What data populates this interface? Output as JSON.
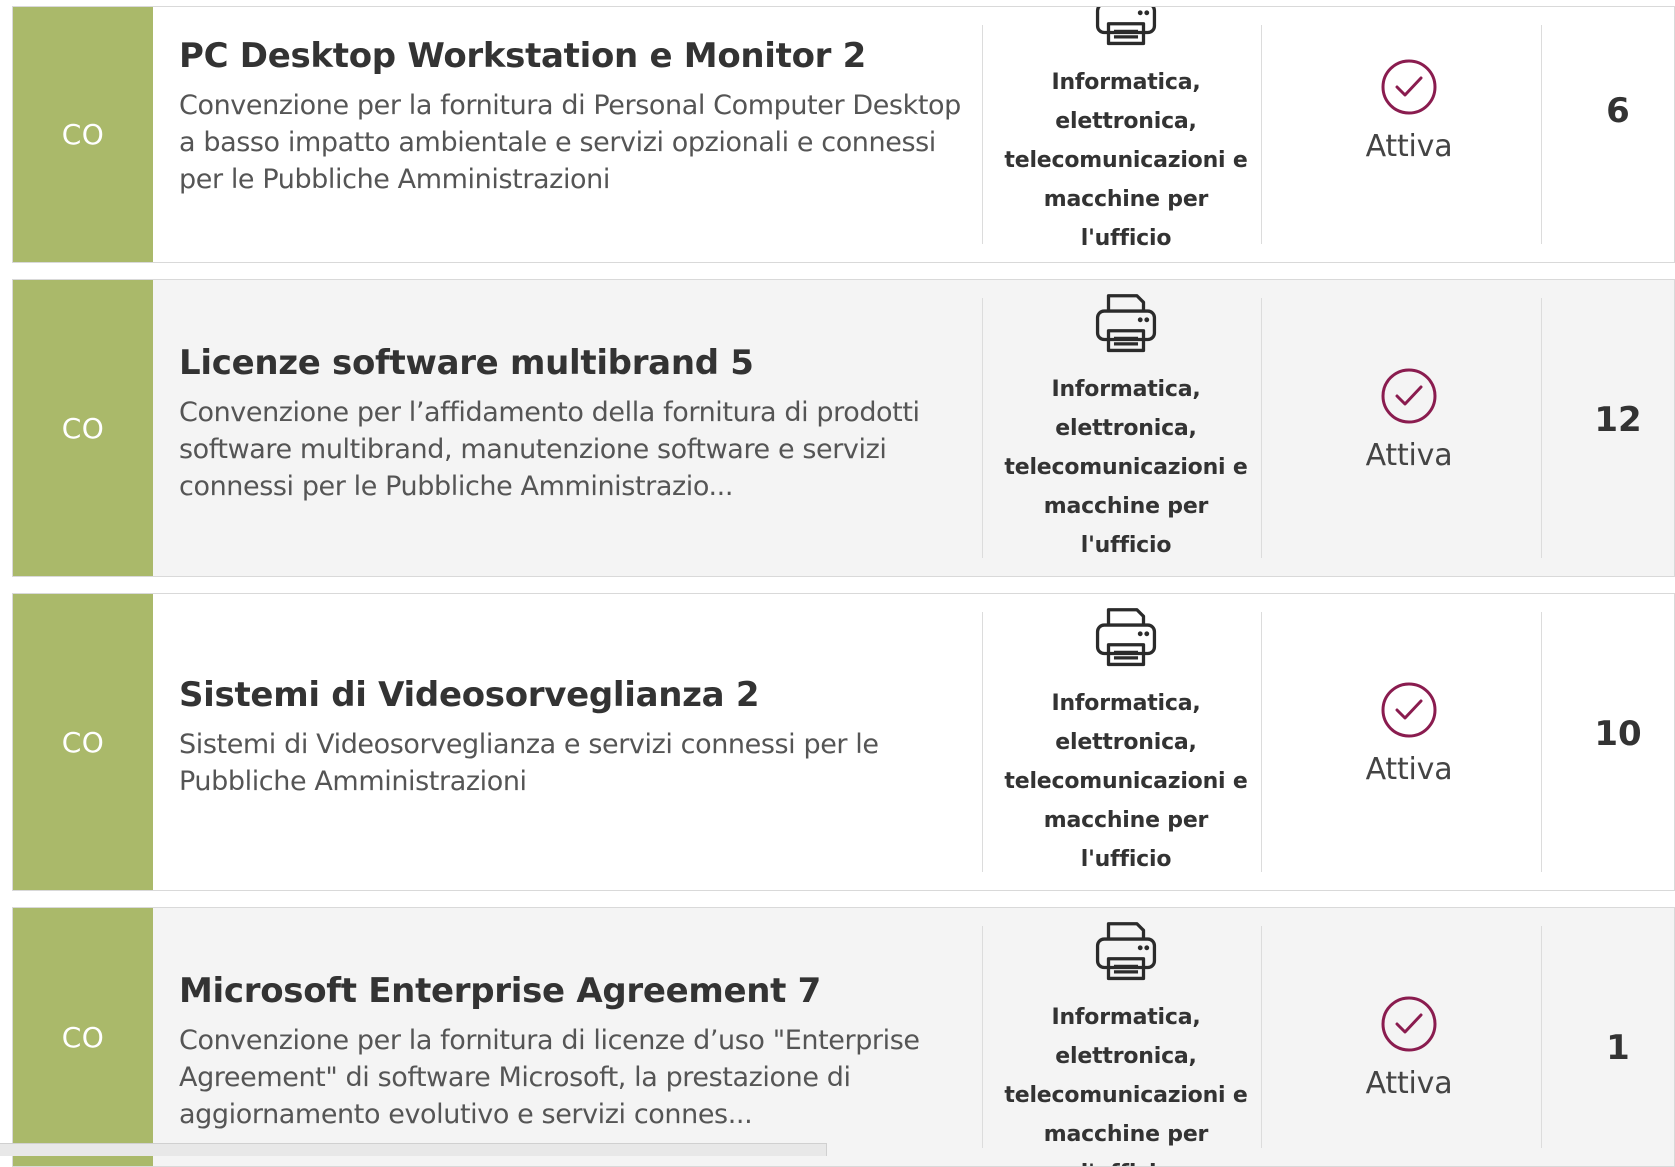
{
  "rows": [
    {
      "badge": "CO",
      "title": "PC Desktop Workstation e Monitor 2",
      "description": "Convenzione per la fornitura di Personal Computer Desktop a basso impatto ambientale e servizi opzionali e connessi per le Pubbliche Amministrazioni",
      "category_icon": "printer-icon",
      "category": "Informatica, elettronica, telecomunicazioni e macchine per l'ufficio",
      "status_icon": "check-circle-icon",
      "status": "Attiva",
      "count": "6"
    },
    {
      "badge": "CO",
      "title": "Licenze software multibrand 5",
      "description": "Convenzione per l’affidamento della fornitura di prodotti software multibrand, manutenzione software e servizi connessi per le Pubbliche Amministrazio...",
      "category_icon": "printer-icon",
      "category": "Informatica, elettronica, telecomunicazioni e macchine per l'ufficio",
      "status_icon": "check-circle-icon",
      "status": "Attiva",
      "count": "12"
    },
    {
      "badge": "CO",
      "title": "Sistemi di Videosorveglianza 2",
      "description": "Sistemi di Videosorveglianza e servizi connessi per le Pubbliche Amministrazioni",
      "category_icon": "printer-icon",
      "category": "Informatica, elettronica, telecomunicazioni e macchine per l'ufficio",
      "status_icon": "check-circle-icon",
      "status": "Attiva",
      "count": "10"
    },
    {
      "badge": "CO",
      "title": "Microsoft Enterprise Agreement 7",
      "description": "Convenzione per la fornitura di licenze d’uso \"Enterprise Agreement\" di software Microsoft, la prestazione di aggiornamento evolutivo e servizi connes...",
      "category_icon": "printer-icon",
      "category": "Informatica, elettronica, telecomunicazioni e macchine per l'ufficio",
      "status_icon": "check-circle-icon",
      "status": "Attiva",
      "count": "1"
    }
  ],
  "colors": {
    "badge_background": "#aab96a",
    "status_icon": "#8a1c4f",
    "row_alt_background": "#f4f4f4"
  }
}
